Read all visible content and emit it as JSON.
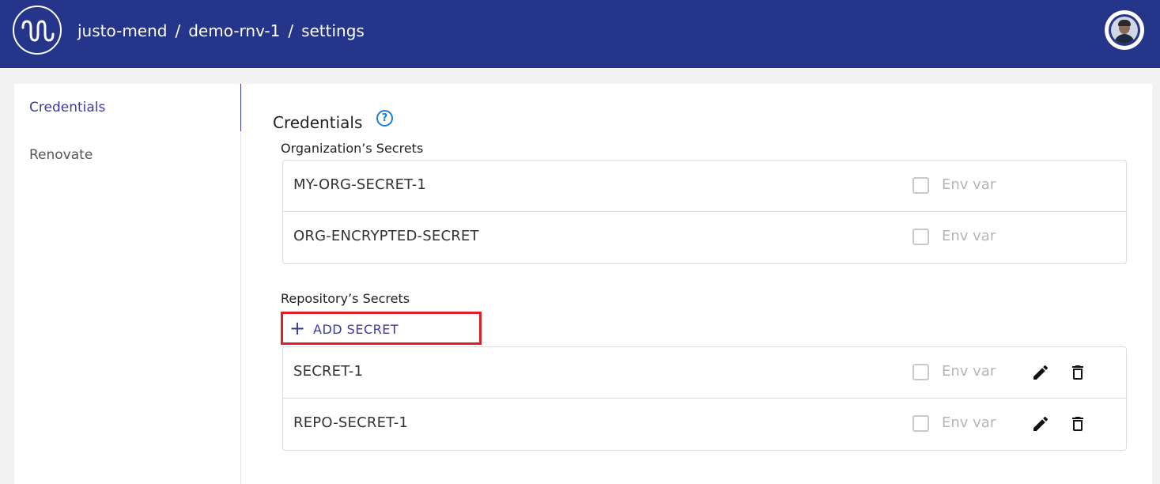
{
  "header": {
    "breadcrumb": [
      "justo-mend",
      "demo-rnv-1",
      "settings"
    ],
    "separator": "/"
  },
  "nav": {
    "items": [
      {
        "label": "Credentials",
        "active": true
      },
      {
        "label": "Renovate",
        "active": false
      }
    ]
  },
  "main": {
    "title": "Credentials",
    "help_icon": "?",
    "org_section": {
      "label": "Organization’s Secrets",
      "secrets": [
        {
          "name": "MY-ORG-SECRET-1",
          "env_label": "Env var",
          "env_checked": false
        },
        {
          "name": "ORG-ENCRYPTED-SECRET",
          "env_label": "Env var",
          "env_checked": false
        }
      ]
    },
    "repo_section": {
      "label": "Repository’s Secrets",
      "add_button": {
        "icon": "+",
        "label": "ADD SECRET"
      },
      "secrets": [
        {
          "name": "SECRET-1",
          "env_label": "Env var",
          "env_checked": false
        },
        {
          "name": "REPO-SECRET-1",
          "env_label": "Env var",
          "env_checked": false
        }
      ]
    }
  },
  "colors": {
    "header_bg": "#24358a",
    "accent": "#3a3aa0",
    "highlight": "#e01e25",
    "help_blue": "#1a7fd6"
  }
}
